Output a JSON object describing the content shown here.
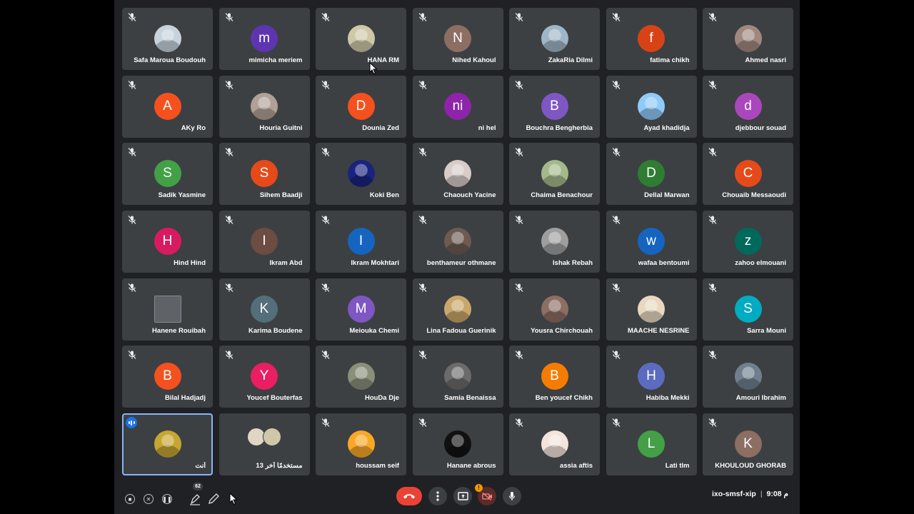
{
  "colors": {
    "stage_bg": "#202124",
    "tile_bg": "#3c4043",
    "leave_red": "#ea4335",
    "speaking_blue": "#8ab4f8"
  },
  "participants": [
    {
      "name": "Safa Maroua Boudouh",
      "initial": "",
      "color": "#c7d2dc",
      "photo": true
    },
    {
      "name": "mimicha meriem",
      "initial": "m",
      "color": "#5e35b1",
      "photo": false
    },
    {
      "name": "HANA RM",
      "initial": "",
      "color": "#cfc8a8",
      "photo": true
    },
    {
      "name": "Nihed Kahoul",
      "initial": "N",
      "color": "#8d6e63",
      "photo": false
    },
    {
      "name": "ZakaRia Dilmi",
      "initial": "",
      "color": "#9fb6c6",
      "photo": true
    },
    {
      "name": "fatima chikh",
      "initial": "f",
      "color": "#d84315",
      "photo": false
    },
    {
      "name": "Ahmed nasri",
      "initial": "",
      "color": "#a1887f",
      "photo": true
    },
    {
      "name": "AKy Ro",
      "initial": "A",
      "color": "#f4511e",
      "photo": false
    },
    {
      "name": "Houria Guitni",
      "initial": "",
      "color": "#b0a097",
      "photo": true
    },
    {
      "name": "Dounia Zed",
      "initial": "D",
      "color": "#f4511e",
      "photo": false
    },
    {
      "name": "ni hel",
      "initial": "ni",
      "color": "#8e24aa",
      "photo": false
    },
    {
      "name": "Bouchra Bengherbia",
      "initial": "B",
      "color": "#7e57c2",
      "photo": false
    },
    {
      "name": "Ayad khadidja",
      "initial": "",
      "color": "#90caf9",
      "photo": true
    },
    {
      "name": "djebbour souad",
      "initial": "d",
      "color": "#ab47bc",
      "photo": false
    },
    {
      "name": "Sadik Yasmine",
      "initial": "S",
      "color": "#43a047",
      "photo": false
    },
    {
      "name": "Sihem Baadji",
      "initial": "S",
      "color": "#e64a19",
      "photo": false
    },
    {
      "name": "Koki Ben",
      "initial": "",
      "color": "#1a237e",
      "photo": true
    },
    {
      "name": "Chaouch Yacine",
      "initial": "",
      "color": "#d7ccc8",
      "photo": true
    },
    {
      "name": "Chaima Benachour",
      "initial": "",
      "color": "#a5b88a",
      "photo": true
    },
    {
      "name": "Dellal Marwan",
      "initial": "D",
      "color": "#2e7d32",
      "photo": false
    },
    {
      "name": "Chouaib Messaoudi",
      "initial": "C",
      "color": "#e64a19",
      "photo": false
    },
    {
      "name": "Hind Hind",
      "initial": "H",
      "color": "#d81b60",
      "photo": false
    },
    {
      "name": "Ikram Abd",
      "initial": "I",
      "color": "#6d4c41",
      "photo": false
    },
    {
      "name": "Ikram Mokhtari",
      "initial": "I",
      "color": "#1565c0",
      "photo": false
    },
    {
      "name": "benthameur othmane",
      "initial": "",
      "color": "#6d5b52",
      "photo": true
    },
    {
      "name": "Ishak Rebah",
      "initial": "",
      "color": "#9e9e9e",
      "photo": true
    },
    {
      "name": "wafaa bentoumi",
      "initial": "w",
      "color": "#1565c0",
      "photo": false
    },
    {
      "name": "zahoo elmouani",
      "initial": "z",
      "color": "#00695c",
      "photo": false
    },
    {
      "name": "Hanene Rouibah",
      "initial": "",
      "color": "#5f6368",
      "photo": true,
      "square": true
    },
    {
      "name": "Karima Boudene",
      "initial": "K",
      "color": "#546e7a",
      "photo": false
    },
    {
      "name": "Meiouka Chemi",
      "initial": "M",
      "color": "#7e57c2",
      "photo": false
    },
    {
      "name": "Lina Fadoua Guerinik",
      "initial": "",
      "color": "#c9a66b",
      "photo": true
    },
    {
      "name": "Yousra Chirchouah",
      "initial": "",
      "color": "#8d6e63",
      "photo": true
    },
    {
      "name": "MAACHE NESRINE",
      "initial": "",
      "color": "#e8d8c0",
      "photo": true
    },
    {
      "name": "Sarra Mouni",
      "initial": "S",
      "color": "#00acc1",
      "photo": false
    },
    {
      "name": "Bilal Hadjadj",
      "initial": "B",
      "color": "#f4511e",
      "photo": false
    },
    {
      "name": "Youcef Bouterfas",
      "initial": "Y",
      "color": "#e91e63",
      "photo": false
    },
    {
      "name": "HouDa Dje",
      "initial": "",
      "color": "#8a8f7a",
      "photo": true
    },
    {
      "name": "Samia Benaissa",
      "initial": "",
      "color": "#6b6b6b",
      "photo": true
    },
    {
      "name": "Ben youcef Chikh",
      "initial": "B",
      "color": "#f57c00",
      "photo": false
    },
    {
      "name": "Habiba Mekki",
      "initial": "H",
      "color": "#5c6bc0",
      "photo": false
    },
    {
      "name": "Amouri Ibrahim",
      "initial": "",
      "color": "#6f7f8f",
      "photo": true
    },
    {
      "name": "أنت",
      "initial": "",
      "color": "#c6a632",
      "photo": true,
      "speaking": true
    },
    {
      "name": "13 مستخدمًا آخر",
      "initial": "",
      "color": "#cfc8a8",
      "photo": true,
      "group": true
    },
    {
      "name": "houssam seif",
      "initial": "",
      "color": "#f9a825",
      "photo": true
    },
    {
      "name": "Hanane abrous",
      "initial": "",
      "color": "#111111",
      "photo": true
    },
    {
      "name": "assia aftis",
      "initial": "",
      "color": "#f3e5dc",
      "photo": true
    },
    {
      "name": "Lati tlm",
      "initial": "L",
      "color": "#43a047",
      "photo": false
    },
    {
      "name": "KHOULOUD GHORAB",
      "initial": "K",
      "color": "#8d6e63",
      "photo": false
    }
  ],
  "controls": {
    "leave": "leave-call",
    "more": "more-options",
    "present": "present-now",
    "camera": "camera-off",
    "mic": "microphone",
    "camera_badge": "!"
  },
  "meeting": {
    "code": "ixo-smsf-xip",
    "separator": "|",
    "time": "9:08 م"
  },
  "annotation_tools": {
    "count": "62"
  }
}
